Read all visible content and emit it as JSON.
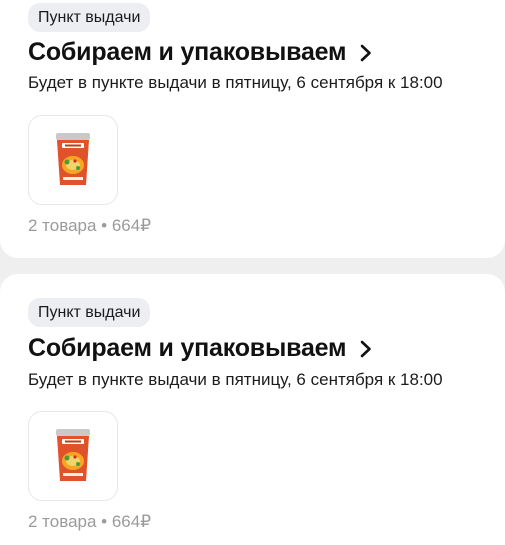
{
  "orders": [
    {
      "badge": "Пункт выдачи",
      "title": "Собираем и упаковываем",
      "delivery": "Будет в пункте выдачи в пятницу, 6 сентября к 18:00",
      "product_icon": "soup-cup-product-icon",
      "summary": "2 товара • 664₽"
    },
    {
      "badge": "Пункт выдачи",
      "title": "Собираем и упаковываем",
      "delivery": "Будет в пункте выдачи в пятницу, 6 сентября к 18:00",
      "product_icon": "soup-cup-product-icon",
      "summary": "2 товара • 664₽"
    }
  ],
  "colors": {
    "background": "#efefef",
    "card": "#ffffff",
    "badge": "#eceef2",
    "muted_text": "#9a9a9a",
    "product_accent": "#e0522a"
  }
}
